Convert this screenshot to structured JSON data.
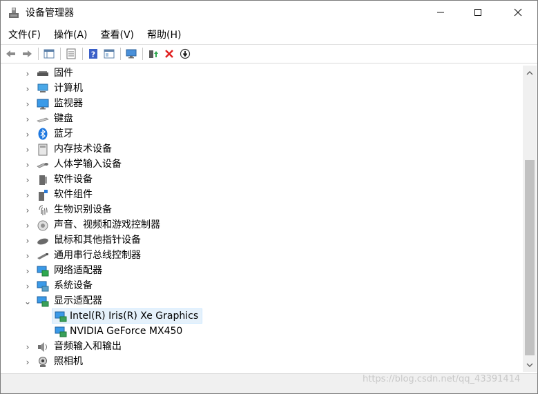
{
  "window": {
    "title": "设备管理器",
    "controls": {
      "minimize": "—",
      "maximize": "☐",
      "close": "✕"
    }
  },
  "menu": [
    "文件(F)",
    "操作(A)",
    "查看(V)",
    "帮助(H)"
  ],
  "toolbar": {
    "buttons": [
      "back-icon",
      "forward-icon",
      "properties-icon",
      "console-tree-icon",
      "help-icon",
      "view-icon",
      "monitor-scan-icon",
      "update-driver-icon",
      "uninstall-icon",
      "disable-icon"
    ]
  },
  "tree": {
    "categories": [
      {
        "label": "固件",
        "icon": "firmware-icon",
        "expanded": false
      },
      {
        "label": "计算机",
        "icon": "computer-icon",
        "expanded": false
      },
      {
        "label": "监视器",
        "icon": "monitor-icon",
        "expanded": false
      },
      {
        "label": "键盘",
        "icon": "keyboard-icon",
        "expanded": false
      },
      {
        "label": "蓝牙",
        "icon": "bluetooth-icon",
        "expanded": false
      },
      {
        "label": "内存技术设备",
        "icon": "memory-icon",
        "expanded": false
      },
      {
        "label": "人体学输入设备",
        "icon": "hid-icon",
        "expanded": false
      },
      {
        "label": "软件设备",
        "icon": "software-device-icon",
        "expanded": false
      },
      {
        "label": "软件组件",
        "icon": "software-component-icon",
        "expanded": false
      },
      {
        "label": "生物识别设备",
        "icon": "biometric-icon",
        "expanded": false
      },
      {
        "label": "声音、视频和游戏控制器",
        "icon": "sound-icon",
        "expanded": false
      },
      {
        "label": "鼠标和其他指针设备",
        "icon": "mouse-icon",
        "expanded": false
      },
      {
        "label": "通用串行总线控制器",
        "icon": "usb-icon",
        "expanded": false
      },
      {
        "label": "网络适配器",
        "icon": "network-icon",
        "expanded": false
      },
      {
        "label": "系统设备",
        "icon": "system-device-icon",
        "expanded": false
      },
      {
        "label": "显示适配器",
        "icon": "display-adapter-icon",
        "expanded": true,
        "children": [
          {
            "label": "Intel(R) Iris(R) Xe Graphics",
            "icon": "display-adapter-icon",
            "selected": true
          },
          {
            "label": "NVIDIA GeForce MX450",
            "icon": "display-adapter-icon",
            "selected": false
          }
        ]
      },
      {
        "label": "音频输入和输出",
        "icon": "audio-io-icon",
        "expanded": false
      },
      {
        "label": "照相机",
        "icon": "camera-icon",
        "expanded": false
      }
    ]
  },
  "watermark": "https://blog.csdn.net/qq_43391414"
}
